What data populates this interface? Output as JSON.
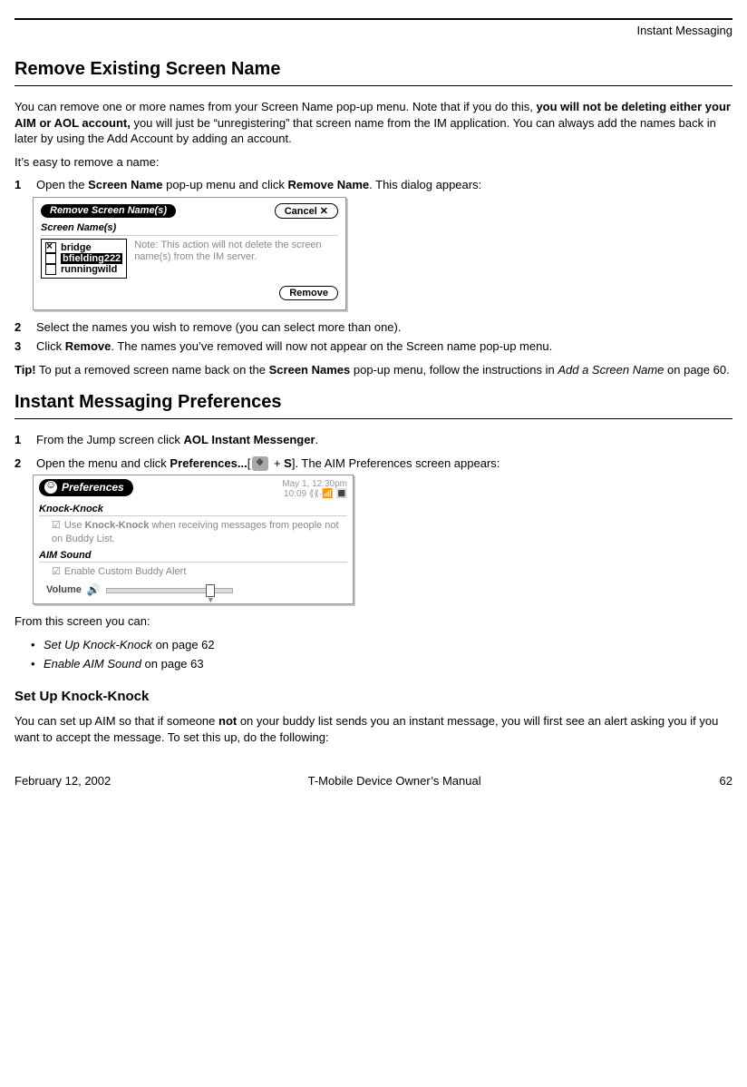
{
  "header": {
    "section": "Instant Messaging"
  },
  "h1a": "Remove Existing Screen Name",
  "intro1a": "You can remove one or more names from your Screen Name pop-up menu. Note that if you do this, ",
  "intro1b": "you will not be deleting either your AIM or AOL account,",
  "intro1c": " you will just be “unregistering” that screen name from the IM application. You can always add the names back in later by using the Add Account by adding an account.",
  "intro2": "It’s easy to remove a name:",
  "step1": {
    "num": "1",
    "a": "Open the ",
    "b": "Screen Name",
    "c": " pop-up menu and click ",
    "d": "Remove Name",
    "e": ". This dialog appears:"
  },
  "dialog1": {
    "title": "Remove Screen Name(s)",
    "cancel": "Cancel",
    "subtitle": "Screen Name(s)",
    "items": {
      "0": "bridge",
      "1": "bfielding222",
      "2": "runningwild"
    },
    "note": "Note: This action will not delete the screen name(s) from the IM server.",
    "remove": "Remove"
  },
  "step2": {
    "num": "2",
    "body": "Select the names you wish to remove (you can select more than one)."
  },
  "step3": {
    "num": "3",
    "a": "Click ",
    "b": "Remove",
    "c": ". The names you’ve removed will now not appear on the Screen name pop-up menu."
  },
  "tip": {
    "a": "Tip!",
    "b": " To put a removed screen name back on the ",
    "c": "Screen Names",
    "d": " pop-up menu, follow the instructions in ",
    "e": "Add a Screen Name",
    "f": " on page 60."
  },
  "h1b": "Instant Messaging Preferences",
  "stepB1": {
    "num": "1",
    "a": "From the Jump screen click ",
    "b": "AOL Instant Messenger",
    "c": "."
  },
  "stepB2": {
    "num": "2",
    "a": "Open the menu and click ",
    "b": "Preferences...",
    "c": "[",
    "d": " + ",
    "e": "S",
    "f": "]. The AIM Preferences screen appears:"
  },
  "dialog2": {
    "title": "Preferences",
    "date": "May 1, 12:30pm",
    "time": "10:09",
    "sec1": "Knock-Knock",
    "opt1a": "Use ",
    "opt1b": "Knock-Knock",
    "opt1c": " when receiving messages from people not on Buddy List.",
    "sec2": "AIM Sound",
    "opt2": "Enable Custom Buddy Alert",
    "vol": "Volume"
  },
  "from_screen": "From this screen you can:",
  "bullets": {
    "b1a": "Set Up Knock-Knock",
    "b1b": " on page 62",
    "b2a": "Enable AIM Sound",
    "b2b": " on page 63"
  },
  "h2": "Set Up Knock-Knock",
  "kk_para_a": "You can set up AIM so that if someone ",
  "kk_para_b": "not",
  "kk_para_c": " on your buddy list sends you an instant message, you will first see an alert asking you if you want to accept the message. To set this up, do the following:",
  "footer": {
    "date": "February 12, 2002",
    "manual": "T-Mobile Device Owner’s Manual",
    "page": "62"
  }
}
